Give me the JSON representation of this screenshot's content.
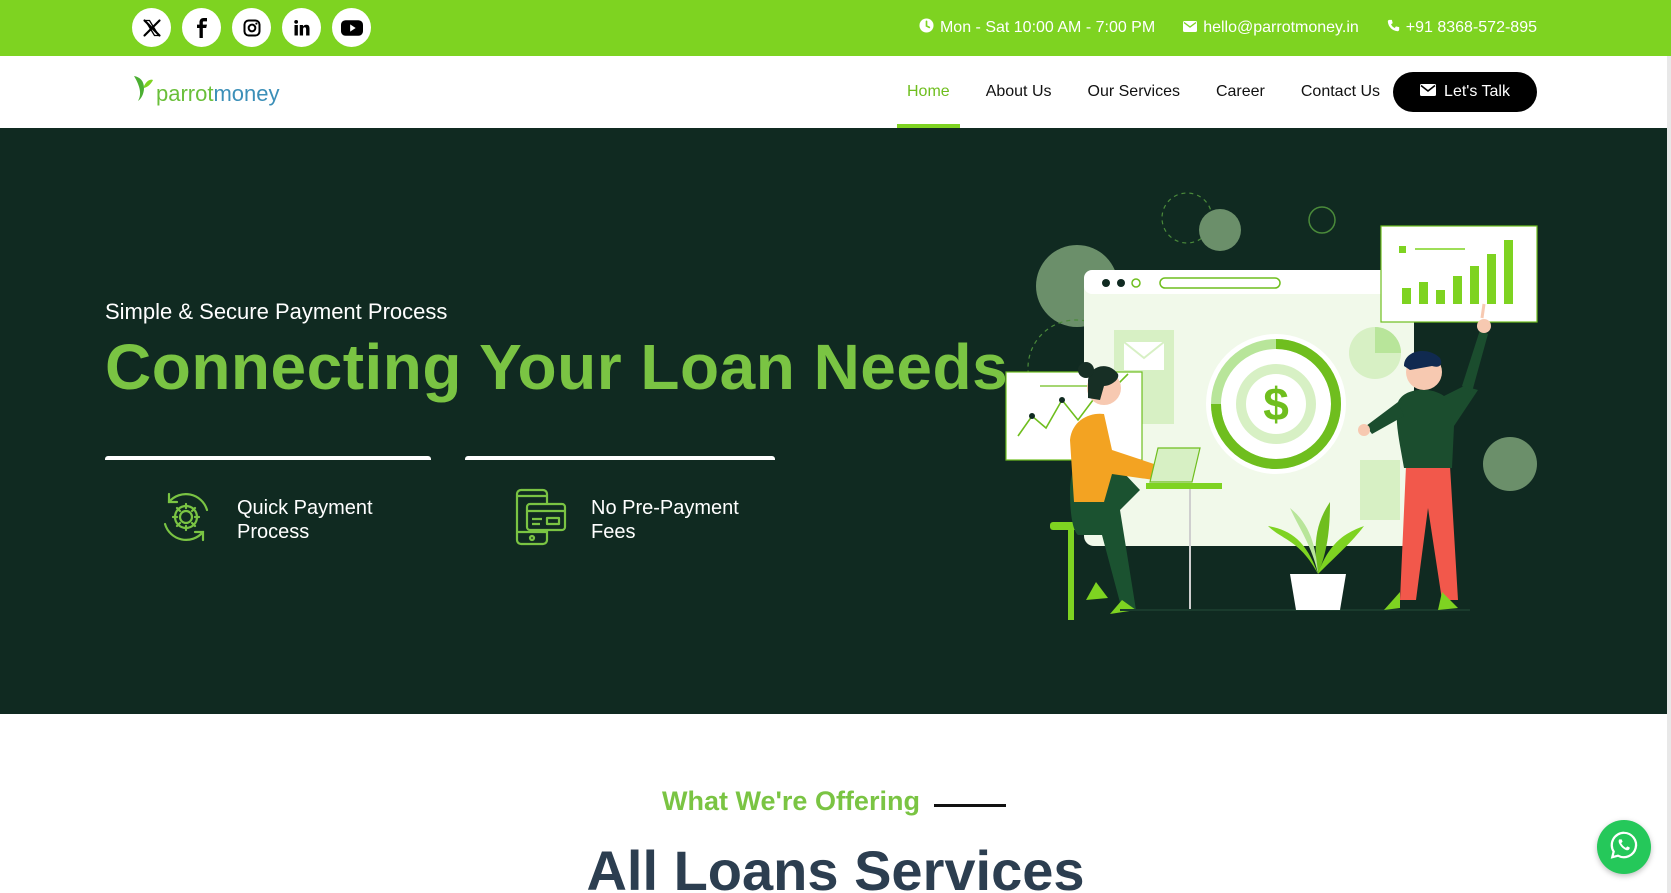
{
  "topbar": {
    "socials": [
      {
        "icon": "x-twitter-icon"
      },
      {
        "icon": "facebook-icon"
      },
      {
        "icon": "instagram-icon"
      },
      {
        "icon": "linkedin-icon"
      },
      {
        "icon": "youtube-icon"
      }
    ],
    "hours": "Mon - Sat 10:00 AM - 7:00 PM",
    "email": "hello@parrotmoney.in",
    "phone": "+91 8368-572-895"
  },
  "brand": {
    "logo_part1": "parrot",
    "logo_part2": "money",
    "accent": "#7ed321",
    "dark": "#102a21"
  },
  "nav": {
    "items": [
      {
        "label": "Home",
        "active": true
      },
      {
        "label": "About Us"
      },
      {
        "label": "Our Services"
      },
      {
        "label": "Career"
      },
      {
        "label": "Contact Us"
      }
    ],
    "cta": "Let's Talk"
  },
  "hero": {
    "subtitle": "Simple & Secure Payment Process",
    "title": "Connecting Your Loan Needs",
    "features": [
      {
        "label": "Quick Payment Process",
        "icon": "gear-refresh-icon"
      },
      {
        "label": "No Pre-Payment Fees",
        "icon": "mobile-card-icon"
      }
    ]
  },
  "offering": {
    "label": "What We're Offering",
    "title": "All Loans Services"
  }
}
